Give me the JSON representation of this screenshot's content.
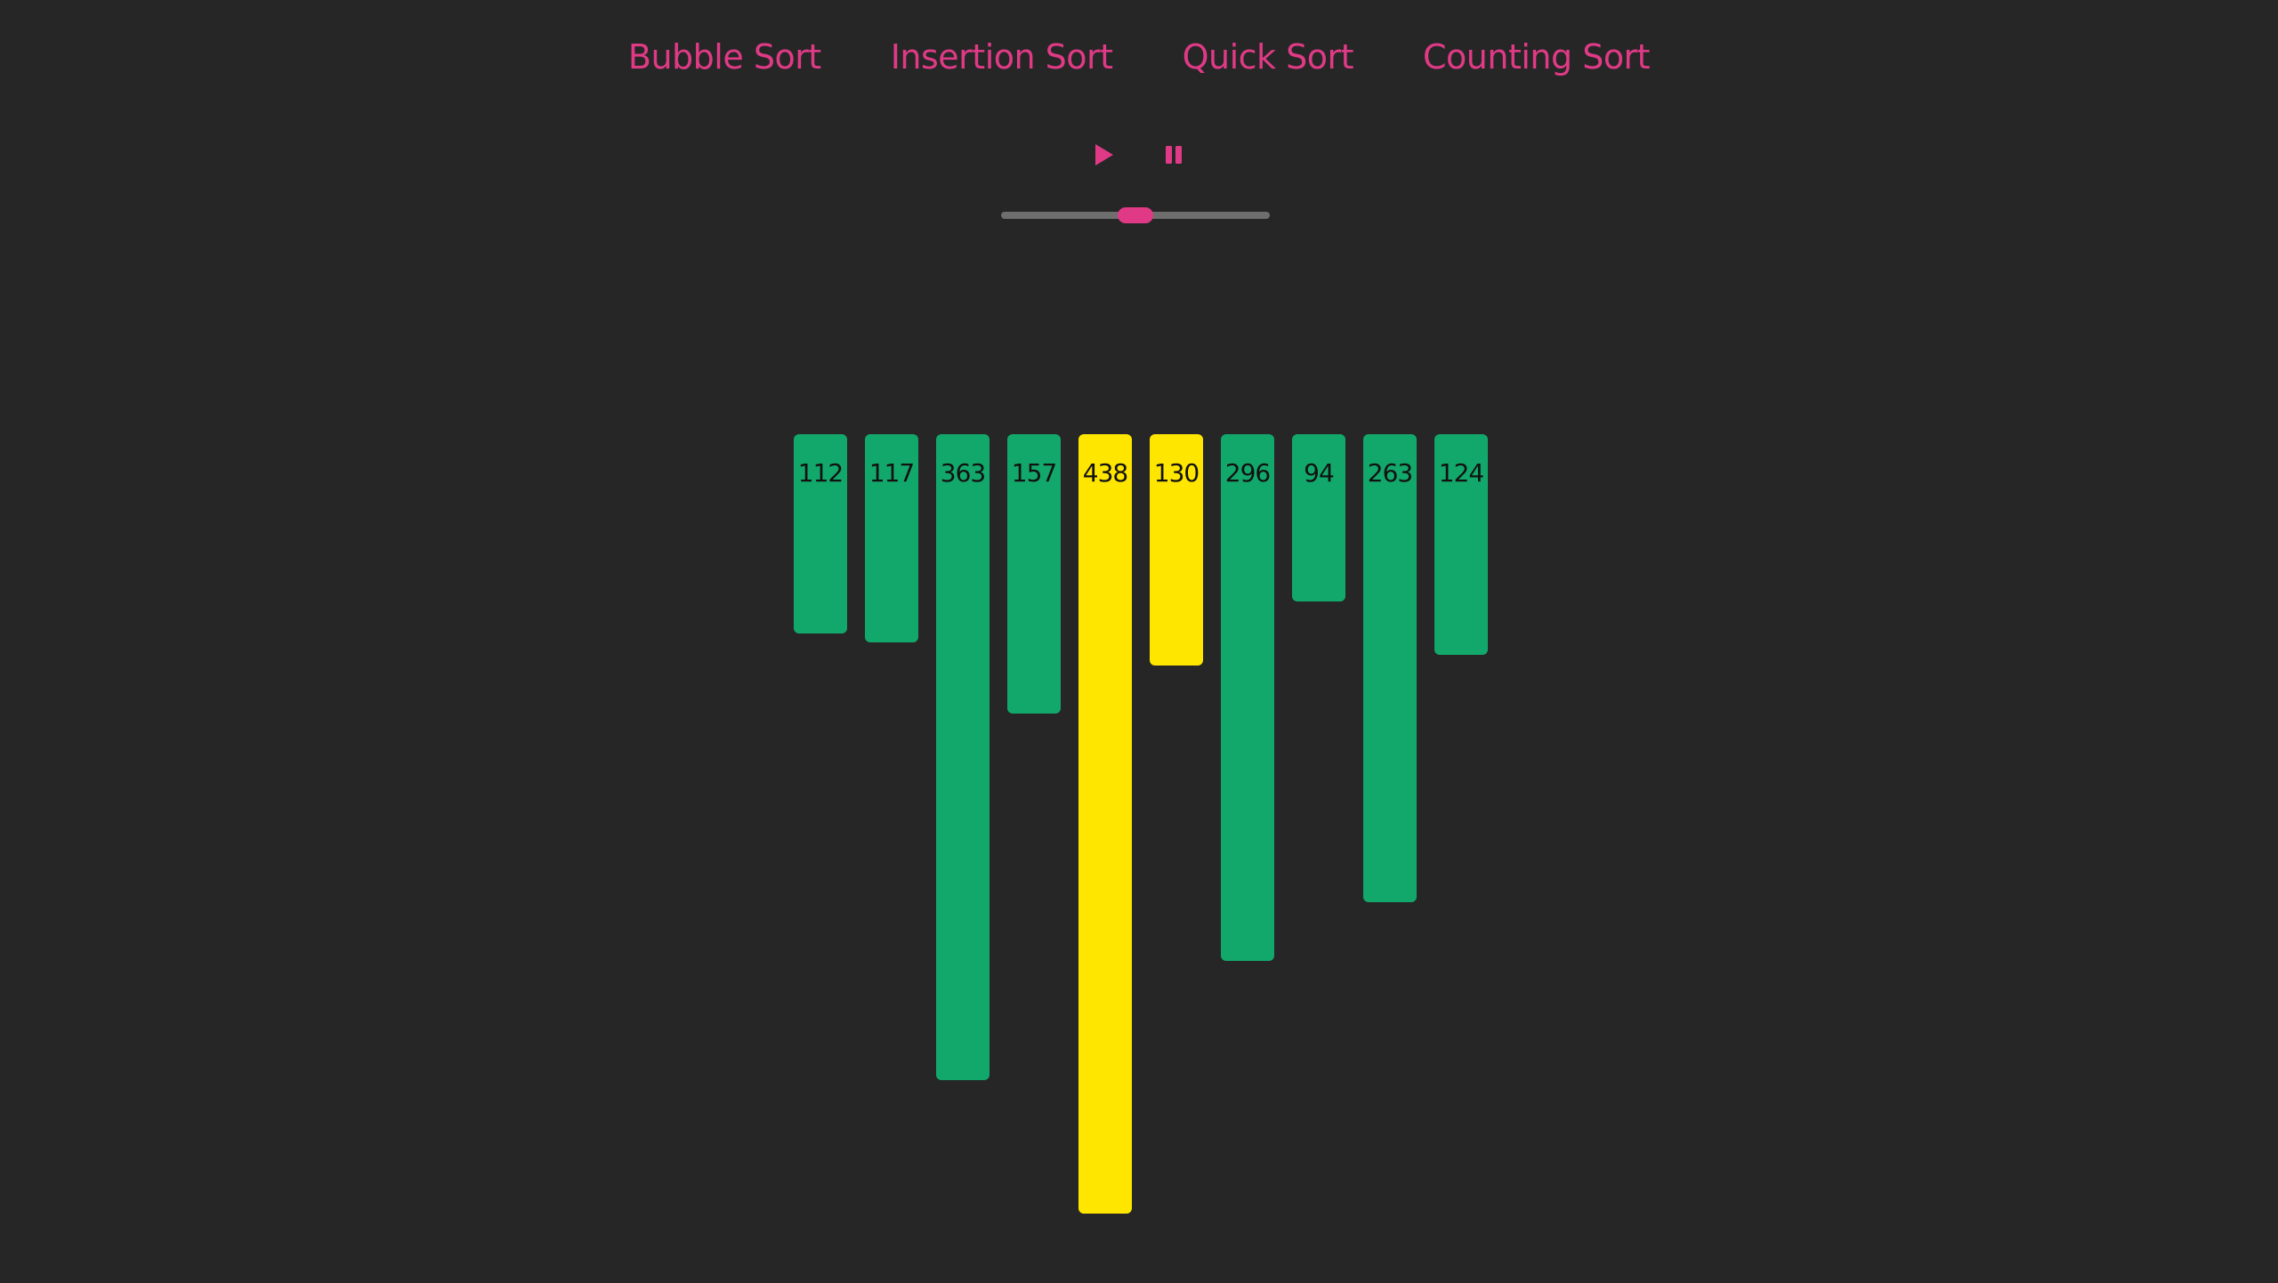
{
  "nav": {
    "items": [
      {
        "label": "Bubble Sort"
      },
      {
        "label": "Insertion Sort"
      },
      {
        "label": "Quick Sort"
      },
      {
        "label": "Counting Sort"
      }
    ]
  },
  "controls": {
    "play_icon": "play-icon",
    "pause_icon": "pause-icon",
    "speed_slider_value": 0.5
  },
  "colors": {
    "background": "#262626",
    "accent": "#e03a86",
    "bar_default": "#13a86b",
    "bar_active": "#ffe600",
    "slider_track": "#6e6e6e"
  },
  "chart_data": {
    "type": "bar",
    "values": [
      112,
      117,
      363,
      157,
      438,
      130,
      296,
      94,
      263,
      124
    ],
    "active_indices": [
      4,
      5
    ]
  }
}
